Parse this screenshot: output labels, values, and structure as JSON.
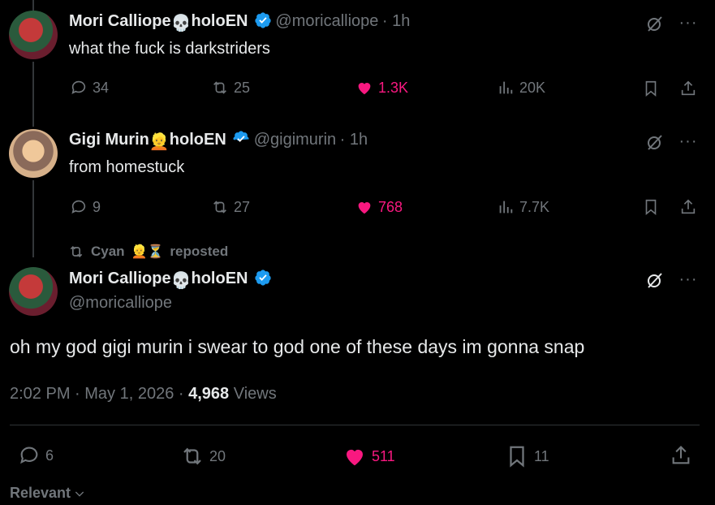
{
  "tweets": [
    {
      "name_part1": "Mori Calliope",
      "name_part2": "holoEN",
      "handle": "@moricalliope",
      "time": "· 1h",
      "text": "what the fuck is darkstriders",
      "replies": "34",
      "reposts": "25",
      "likes": "1.3K",
      "views": "20K"
    },
    {
      "name_part1": "Gigi Murin",
      "name_part2": "holoEN",
      "handle": "@gigimurin",
      "time": "· 1h",
      "text": "from homestuck",
      "replies": "9",
      "reposts": "27",
      "likes": "768",
      "views": "7.7K"
    }
  ],
  "repost_banner": {
    "user": "Cyan",
    "label": "reposted"
  },
  "main_tweet": {
    "name_part1": "Mori Calliope",
    "name_part2": "holoEN",
    "handle": "@moricalliope",
    "text": "oh my god gigi murin i swear to god one of these days im gonna snap",
    "timestamp": "2:02 PM · May 1, 2026 · ",
    "views_count": "4,968",
    "views_label": " Views",
    "replies": "6",
    "reposts": "20",
    "likes": "511",
    "bookmarks": "11"
  },
  "sort_label": "Relevant",
  "colors": {
    "accent_like": "#f91880",
    "verified": "#1d9bf0",
    "muted": "#71767b"
  }
}
